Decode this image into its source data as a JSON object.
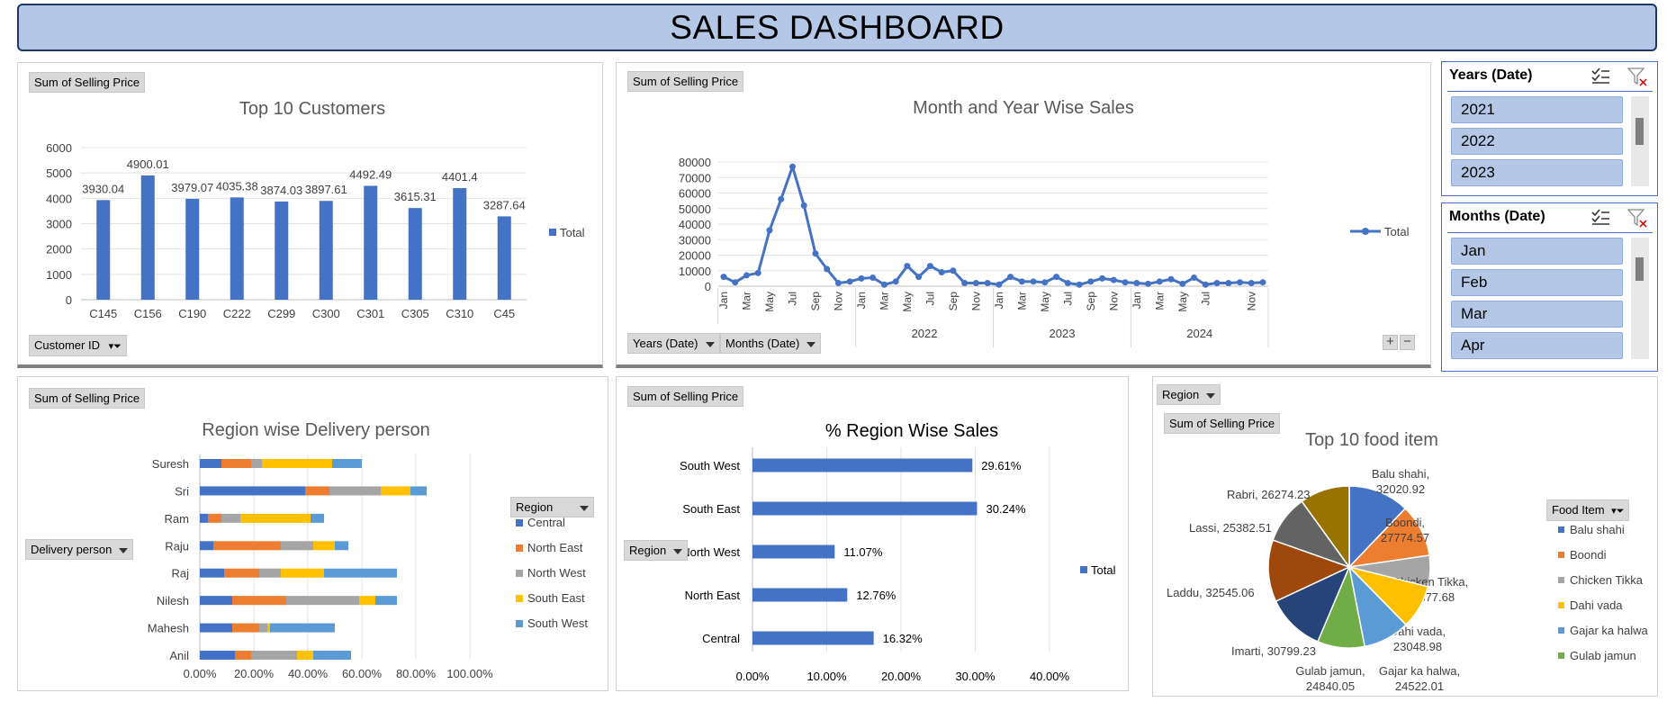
{
  "title": "SALES DASHBOARD",
  "customers_panel": {
    "value_field": "Sum of Selling Price",
    "axis_field": "Customer ID"
  },
  "monthly_panel": {
    "value_field": "Sum of Selling Price",
    "years_field": "Years (Date)",
    "months_field": "Months (Date)",
    "expand_label": "+",
    "collapse_label": "−"
  },
  "years_slicer": {
    "title": "Years (Date)",
    "items": [
      "2021",
      "2022",
      "2023"
    ]
  },
  "months_slicer": {
    "title": "Months (Date)",
    "items": [
      "Jan",
      "Feb",
      "Mar",
      "Apr"
    ]
  },
  "delivery_panel": {
    "value_field": "Sum of Selling Price",
    "axis_field": "Delivery person",
    "legend_field": "Region"
  },
  "region_panel": {
    "value_field": "Sum of Selling Price",
    "axis_field": "Region"
  },
  "food_panel": {
    "filter_field": "Region",
    "value_field": "Sum of Selling Price",
    "legend_field": "Food Item"
  },
  "colors": {
    "blue": "#4472c4",
    "orange": "#ed7d31",
    "gray": "#a5a5a5",
    "yellow": "#ffc000",
    "light_blue": "#5b9bd5",
    "green": "#70ad47",
    "dark_blue": "#264478",
    "dark_orange": "#9e480e",
    "dark_gray": "#636363",
    "dark_yellow": "#997300"
  },
  "chart_data": [
    {
      "id": "top-customers",
      "type": "bar",
      "title": "Top 10 Customers",
      "categories": [
        "C145",
        "C156",
        "C190",
        "C222",
        "C299",
        "C300",
        "C301",
        "C305",
        "C310",
        "C45"
      ],
      "series": [
        {
          "name": "Total",
          "values": [
            3930.04,
            4900.01,
            3979.07,
            4035.38,
            3874.03,
            3897.61,
            4492.49,
            3615.31,
            4401.4,
            3287.64
          ]
        }
      ],
      "data_labels": [
        "3930.04",
        "4900.01",
        "3979.07",
        "4035.38",
        "3874.03",
        "3897.61",
        "4492.49",
        "3615.31",
        "4401.4",
        "3287.64"
      ],
      "ylim": [
        0,
        6000
      ],
      "yticks": [
        "0",
        "1000",
        "2000",
        "3000",
        "4000",
        "5000",
        "6000"
      ],
      "grid": true,
      "legend": "right"
    },
    {
      "id": "monthly-sales",
      "type": "line",
      "title": "Month and Year Wise Sales",
      "x": [
        "Jan",
        "Feb",
        "Mar",
        "Apr",
        "May",
        "Jun",
        "Jul",
        "Aug",
        "Sep",
        "Oct",
        "Nov",
        "Dec",
        "Jan",
        "Feb",
        "Mar",
        "Apr",
        "May",
        "Jun",
        "Jul",
        "Aug",
        "Sep",
        "Oct",
        "Nov",
        "Dec",
        "Jan",
        "Feb",
        "Mar",
        "Apr",
        "May",
        "Jun",
        "Jul",
        "Aug",
        "Sep",
        "Oct",
        "Nov",
        "Dec",
        "Jan",
        "Feb",
        "Mar",
        "Apr",
        "May",
        "Jun",
        "Jul",
        "Aug",
        "Sep",
        "Oct",
        "Nov",
        "Dec"
      ],
      "x_tick_labels": [
        "Jan",
        "Mar",
        "May",
        "Jul",
        "Sep",
        "Nov",
        "Jan",
        "Mar",
        "May",
        "Jul",
        "Sep",
        "Nov",
        "Jan",
        "Mar",
        "May",
        "Jul",
        "Sep",
        "Nov",
        "Jan",
        "Mar",
        "May",
        "Jul",
        "Nov"
      ],
      "x_tick_months": [
        0,
        2,
        4,
        6,
        8,
        10,
        12,
        14,
        16,
        18,
        20,
        22,
        24,
        26,
        28,
        30,
        32,
        34,
        36,
        38,
        40,
        42,
        46
      ],
      "year_groups": [
        {
          "label": "",
          "start": 0,
          "end": 12
        },
        {
          "label": "2022",
          "start": 12,
          "end": 24
        },
        {
          "label": "2023",
          "start": 24,
          "end": 36
        },
        {
          "label": "2024",
          "start": 36,
          "end": 48
        }
      ],
      "series": [
        {
          "name": "Total",
          "values": [
            6000,
            2500,
            7000,
            8500,
            36000,
            56000,
            77000,
            52000,
            21000,
            11000,
            2000,
            3000,
            5000,
            5500,
            1000,
            3000,
            13000,
            6000,
            13000,
            9000,
            10000,
            2000,
            2000,
            2000,
            1000,
            6000,
            3000,
            3000,
            2500,
            6000,
            2000,
            1000,
            3000,
            5000,
            4000,
            2500,
            2000,
            1500,
            3000,
            4500,
            1500,
            5500,
            1000,
            2000,
            2000,
            2500,
            2000,
            2500
          ]
        }
      ],
      "ylim": [
        0,
        80000
      ],
      "yticks": [
        "0",
        "10000",
        "20000",
        "30000",
        "40000",
        "50000",
        "60000",
        "70000",
        "80000"
      ],
      "grid": true,
      "legend": "right"
    },
    {
      "id": "delivery-person",
      "type": "bar",
      "orientation": "horizontal-stacked",
      "title": "Region wise Delivery person",
      "categories": [
        "Suresh",
        "Sri",
        "Ram",
        "Raju",
        "Raj",
        "Nilesh",
        "Mahesh",
        "Anil"
      ],
      "series": [
        {
          "name": "Central",
          "values": [
            0.08,
            0.39,
            0.03,
            0.05,
            0.09,
            0.12,
            0.12,
            0.13
          ]
        },
        {
          "name": "North East",
          "values": [
            0.11,
            0.09,
            0.05,
            0.25,
            0.13,
            0.2,
            0.1,
            0.06
          ]
        },
        {
          "name": "North West",
          "values": [
            0.04,
            0.19,
            0.07,
            0.12,
            0.08,
            0.27,
            0.03,
            0.17
          ]
        },
        {
          "name": "South East",
          "values": [
            0.26,
            0.11,
            0.26,
            0.08,
            0.16,
            0.06,
            0.01,
            0.06
          ]
        },
        {
          "name": "South West",
          "values": [
            0.11,
            0.06,
            0.05,
            0.05,
            0.27,
            0.08,
            0.24,
            0.14
          ]
        }
      ],
      "xlim": [
        0,
        1.0
      ],
      "xticks": [
        "0.00%",
        "20.00%",
        "40.00%",
        "60.00%",
        "80.00%",
        "100.00%"
      ],
      "grid": true,
      "legend": "right"
    },
    {
      "id": "region-sales",
      "type": "bar",
      "orientation": "horizontal",
      "title": "% Region Wise Sales",
      "categories": [
        "South West",
        "South East",
        "North West",
        "North East",
        "Central"
      ],
      "series": [
        {
          "name": "Total",
          "values": [
            29.61,
            30.24,
            11.07,
            12.76,
            16.32
          ]
        }
      ],
      "data_labels": [
        "29.61%",
        "30.24%",
        "11.07%",
        "12.76%",
        "16.32%"
      ],
      "xlim": [
        0,
        40
      ],
      "xticks": [
        "0.00%",
        "10.00%",
        "20.00%",
        "30.00%",
        "40.00%"
      ],
      "grid": true,
      "legend": "right"
    },
    {
      "id": "top-food",
      "type": "pie",
      "title": "Top 10 food item",
      "categories": [
        "Balu shahi",
        "Boondi",
        "Chicken Tikka",
        "Dahi vada",
        "Gajar ka halwa",
        "Gulab jamun",
        "Imarti",
        "Laddu",
        "Lassi",
        "Rabri"
      ],
      "values": [
        32020.92,
        27774.57,
        16377.68,
        23048.98,
        24522.01,
        24840.05,
        30799.23,
        32545.06,
        25382.51,
        26274.23
      ],
      "slice_labels": [
        [
          "Balu shahi,",
          "32020.92"
        ],
        [
          "Boondi,",
          "27774.57"
        ],
        [
          "Chicken Tikka,",
          "16377.68"
        ],
        [
          "Dahi vada,",
          "23048.98"
        ],
        [
          "Gajar ka halwa,",
          "24522.01"
        ],
        [
          "Gulab jamun,",
          "24840.05"
        ],
        [
          "Imarti, 30799.23"
        ],
        [
          "Laddu, 32545.06"
        ],
        [
          "Lassi, 25382.51"
        ],
        [
          "Rabri, 26274.23"
        ]
      ],
      "legend_visible": [
        "Balu shahi",
        "Boondi",
        "Chicken Tikka",
        "Dahi vada",
        "Gajar ka halwa",
        "Gulab jamun"
      ],
      "legend": "right"
    }
  ]
}
